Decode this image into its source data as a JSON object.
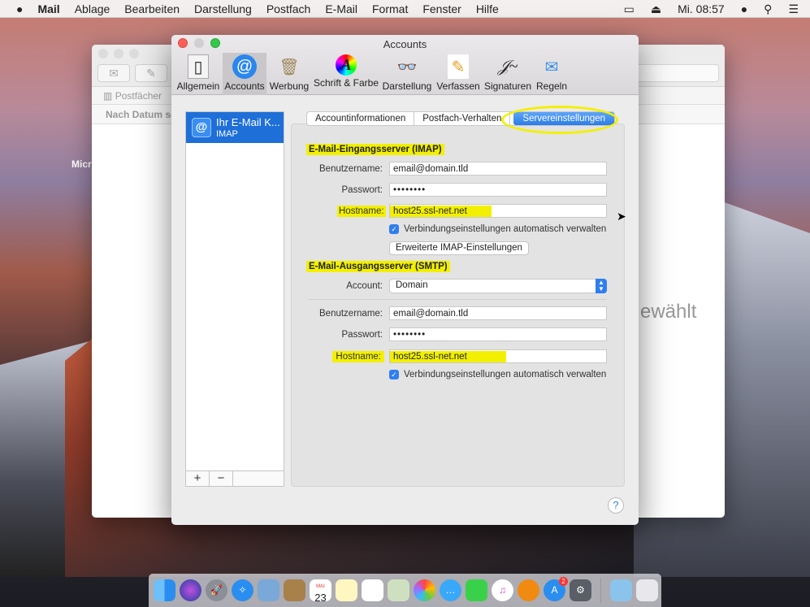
{
  "menubar": {
    "apple": "",
    "app": "Mail",
    "items": [
      "Ablage",
      "Bearbeiten",
      "Darstellung",
      "Postfach",
      "E-Mail",
      "Format",
      "Fenster",
      "Hilfe"
    ],
    "clock": "Mi. 08:57",
    "icons": [
      "display-mirroring-icon",
      "eject-icon",
      "user-icon",
      "spotlight-search-icon",
      "notification-center-icon"
    ]
  },
  "desktop": {
    "partial_label": "Micr"
  },
  "background_window": {
    "mailboxes_label": "Postfächer",
    "sort_label": "Nach Datum so",
    "empty_text": "ewählt"
  },
  "prefs": {
    "title": "Accounts",
    "toolbar": [
      {
        "label": "Allgemein",
        "icon": "general-switch-icon"
      },
      {
        "label": "Accounts",
        "icon": "at-sign-icon",
        "selected": true
      },
      {
        "label": "Werbung",
        "icon": "junk-mail-icon"
      },
      {
        "label": "Schrift & Farbe",
        "icon": "fonts-colors-icon"
      },
      {
        "label": "Darstellung",
        "icon": "viewing-glasses-icon"
      },
      {
        "label": "Verfassen",
        "icon": "compose-pencil-icon"
      },
      {
        "label": "Signaturen",
        "icon": "signature-icon"
      },
      {
        "label": "Regeln",
        "icon": "rules-envelope-icon"
      }
    ],
    "account": {
      "name": "Ihr E-Mail K...",
      "type": "IMAP"
    },
    "list_buttons": {
      "add": "+",
      "remove": "−"
    },
    "tabs": [
      "Accountinformationen",
      "Postfach-Verhalten",
      "Servereinstellungen"
    ],
    "selected_tab": "Servereinstellungen",
    "incoming": {
      "heading": "E-Mail-Eingangsserver (IMAP)",
      "username_label": "Benutzername:",
      "username": "email@domain.tld",
      "password_label": "Passwort:",
      "password": "••••••••",
      "hostname_label": "Hostname:",
      "hostname": "host25.ssl-net.net",
      "auto_label": "Verbindungseinstellungen automatisch verwalten",
      "auto_checked": true,
      "advanced_button": "Erweiterte IMAP-Einstellungen"
    },
    "outgoing": {
      "heading": "E-Mail-Ausgangsserver (SMTP)",
      "account_label": "Account:",
      "account": "Domain",
      "username_label": "Benutzername:",
      "username": "email@domain.tld",
      "password_label": "Passwort:",
      "password": "••••••••",
      "hostname_label": "Hostname:",
      "hostname": "host25.ssl-net.net",
      "auto_label": "Verbindungseinstellungen automatisch verwalten",
      "auto_checked": true
    },
    "help": "?"
  },
  "colors": {
    "highlight": "#f2f000",
    "accent": "#2f7ef0",
    "selection": "#1e6fd8"
  },
  "dock": {
    "badge": "2",
    "calendar_day": "23",
    "calendar_month": "MAI",
    "apps": [
      "finder-icon",
      "siri-icon",
      "launchpad-icon",
      "safari-icon",
      "mail-icon",
      "contacts-icon",
      "calendar-icon",
      "notes-icon",
      "reminders-icon",
      "maps-icon",
      "photos-icon",
      "messages-icon",
      "facetime-icon",
      "itunes-icon",
      "ibooks-icon",
      "app-store-icon",
      "system-preferences-icon",
      "downloads-folder-icon",
      "trash-icon"
    ]
  }
}
